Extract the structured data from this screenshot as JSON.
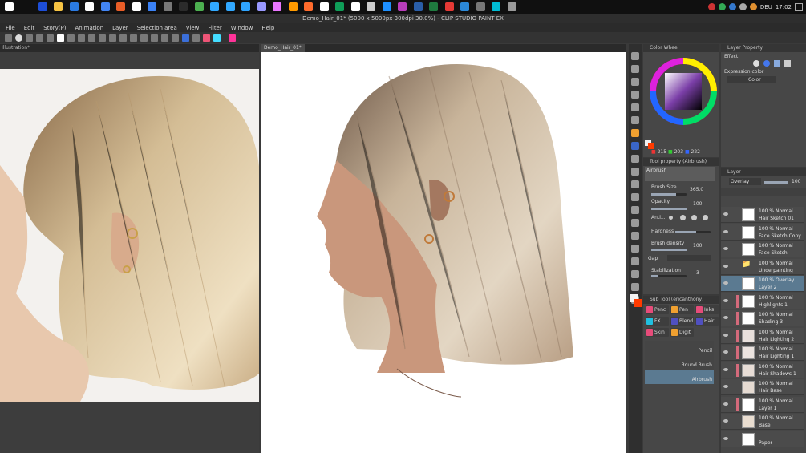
{
  "taskbar": {
    "tray": {
      "language": "DEU",
      "time": "17:02"
    },
    "icon_colors": [
      "#ffffff",
      "#1d4ed8",
      "#f6c343",
      "#2a7ae2",
      "#ffffff",
      "#4285f4",
      "#e85d27",
      "#ffffff",
      "#3b82f6",
      "#777777",
      "#2b2b2b",
      "#4caf50",
      "#31a8ff",
      "#31a8ff",
      "#2fa4ff",
      "#9999ff",
      "#ea77ff",
      "#ff9a00",
      "#ff6b2c",
      "#ffffff",
      "#0f9d58",
      "#ffffff",
      "#cccccc",
      "#1e90ff",
      "#b83dba",
      "#2a5ea8",
      "#1f7a3f",
      "#e53935",
      "#2b88d8",
      "#777777",
      "#00bcd4",
      "#999999"
    ]
  },
  "window": {
    "title": "Demo_Hair_01* (5000 x 5000px 300dpi 30.0%) - CLIP STUDIO PAINT EX"
  },
  "menu": [
    "File",
    "Edit",
    "Story(P)",
    "Animation",
    "Layer",
    "Selection area",
    "View",
    "Filter",
    "Window",
    "Help"
  ],
  "tabs": {
    "reference": "Illustration*",
    "canvas": "Demo_Hair_01*"
  },
  "color_wheel": {
    "title": "Color Wheel",
    "r": "215",
    "g": "203",
    "b": "222",
    "main_color": "#ff3b00",
    "sub_color": "#f2f2f2"
  },
  "layer_property": {
    "title": "Layer Property",
    "effect_label": "Effect",
    "expression_label": "Expression color",
    "expression_value": "Color"
  },
  "tool_property": {
    "title": "Tool property (Airbrush)",
    "tool": "Airbrush",
    "brush_size_label": "Brush Size",
    "brush_size": "365.0",
    "opacity_label": "Opacity",
    "opacity": "100",
    "opacity_level": 1.0,
    "anti_label": "Anti...",
    "hardness_label": "Hardness",
    "density_label": "Brush density",
    "density": "100",
    "gap_label": "Gap",
    "stab_label": "Stabilization",
    "stab": "3"
  },
  "sub_tool": {
    "title": "Sub Tool (ericanthony)",
    "chips": [
      {
        "label": "Penc",
        "color": "#e74c7a"
      },
      {
        "label": "Pen",
        "color": "#f0a030"
      },
      {
        "label": "Inks",
        "color": "#e74c7a"
      },
      {
        "label": "FX",
        "color": "#20c0e0"
      },
      {
        "label": "Blend",
        "color": "#5050c0"
      },
      {
        "label": "Hair",
        "color": "#5050c0"
      },
      {
        "label": "Skin",
        "color": "#e74c7a"
      },
      {
        "label": "Digit",
        "color": "#f0a030"
      }
    ],
    "brushes": [
      "Pencil",
      "Round Brush",
      "Airbrush"
    ]
  },
  "layers": {
    "title": "Layer",
    "blend_mode": "Overlay",
    "opacity": "100",
    "items": [
      {
        "mode": "100 % Normal",
        "name": "Hair Sketch 01",
        "thumb": "#ffffff",
        "selected": false,
        "marker": false
      },
      {
        "mode": "100 % Normal",
        "name": "Face Sketch Copy",
        "thumb": "#ffffff",
        "selected": false,
        "marker": false
      },
      {
        "mode": "100 % Normal",
        "name": "Face Sketch",
        "thumb": "#ffffff",
        "selected": false,
        "marker": false
      },
      {
        "mode": "100 % Normal",
        "name": "Underpainting",
        "thumb": "#4b4b4b",
        "selected": false,
        "marker": false,
        "folder": true
      },
      {
        "mode": "100 % Overlay",
        "name": "Layer 2",
        "thumb": "#ffffff",
        "selected": true,
        "marker": false
      },
      {
        "mode": "100 % Normal",
        "name": "Highlights 1",
        "thumb": "#ffffff",
        "selected": false,
        "marker": true
      },
      {
        "mode": "100 % Normal",
        "name": "Shading 3",
        "thumb": "#ffffff",
        "selected": false,
        "marker": true
      },
      {
        "mode": "100 % Normal",
        "name": "Hair Lighting 2",
        "thumb": "#e8e0dc",
        "selected": false,
        "marker": true
      },
      {
        "mode": "100 % Normal",
        "name": "Hair Lighting 1",
        "thumb": "#ece4e0",
        "selected": false,
        "marker": true
      },
      {
        "mode": "100 % Normal",
        "name": "Hair Shadows 1",
        "thumb": "#e8ddd6",
        "selected": false,
        "marker": true
      },
      {
        "mode": "100 % Normal",
        "name": "Hair Base",
        "thumb": "#e6dbd2",
        "selected": false,
        "marker": false
      },
      {
        "mode": "100 % Normal",
        "name": "Layer 1",
        "thumb": "#ffffff",
        "selected": false,
        "marker": true
      },
      {
        "mode": "100 % Normal",
        "name": "Base",
        "thumb": "#e9ddd0",
        "selected": false,
        "marker": false
      },
      {
        "mode": "",
        "name": "Paper",
        "thumb": "#ffffff",
        "selected": false,
        "marker": false
      }
    ]
  }
}
